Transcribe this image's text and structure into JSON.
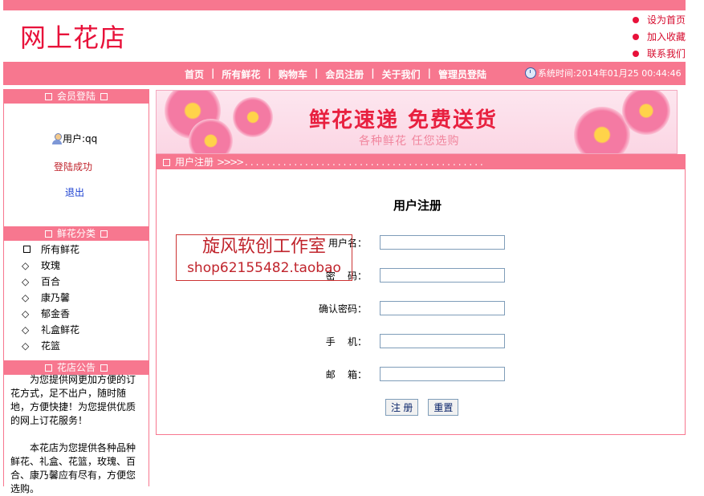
{
  "site": {
    "logo": "网上花店"
  },
  "toplinks": [
    "设为首页",
    "加入收藏",
    "联系我们"
  ],
  "nav": {
    "items": [
      "首页",
      "所有鲜花",
      "购物车",
      "会员注册",
      "关于我们",
      "管理员登陆"
    ],
    "separator": "|",
    "system_time": "系统时间:2014年01月25 00:44:46"
  },
  "sidebar": {
    "login_title": "会员登陆",
    "user_label": "用户:",
    "username": "qq",
    "login_status": "登陆成功",
    "logout": "退出",
    "category_title": "鲜花分类",
    "categories": [
      "所有鲜花",
      "玫瑰",
      "百合",
      "康乃馨",
      "郁金香",
      "礼盒鲜花",
      "花篮"
    ],
    "notice_title": "花店公告",
    "notice_p1": "为您提供网更加方便的订花方式，足不出户，随时随地，方便快捷！为您提供优质的网上订花服务！",
    "notice_p2": "本花店为您提供各种品种鲜花、礼盒、花篮，玫瑰、百合、康乃馨应有尽有，方便您选购。"
  },
  "banner": {
    "title": "鲜花速递  免费送货",
    "subtitle": "各种鲜花 任您选购"
  },
  "main": {
    "header": "用户注册",
    "arrows": ">>>>",
    "dots": "............................................",
    "form_title": "用户注册",
    "fields": [
      {
        "label": "用户名：",
        "value": ""
      },
      {
        "label": "密    码：",
        "value": ""
      },
      {
        "label": "确认密码：",
        "value": ""
      },
      {
        "label": "手    机：",
        "value": ""
      },
      {
        "label": "邮    箱：",
        "value": ""
      }
    ],
    "submit": "注 册",
    "reset": "重置"
  },
  "watermark": {
    "line1": "旋风软创工作室",
    "line2": "shop62155482.taobao"
  },
  "colors": {
    "pink": "#f7778f",
    "logo_red": "#e8113a"
  }
}
